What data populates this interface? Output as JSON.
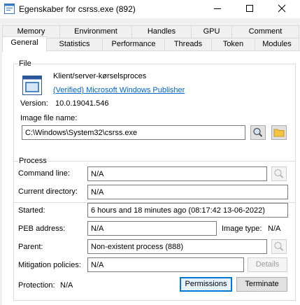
{
  "window": {
    "title": "Egenskaber for csrss.exe (892)"
  },
  "tabs": {
    "back_row": [
      "Memory",
      "Environment",
      "Handles",
      "GPU",
      "Comment"
    ],
    "front_row": [
      "General",
      "Statistics",
      "Performance",
      "Threads",
      "Token",
      "Modules"
    ],
    "active": "General"
  },
  "file": {
    "group_label": "File",
    "description": "Klient/server-kørselsproces",
    "publisher_link": "(Verified) Microsoft Windows Publisher",
    "version_label": "Version:",
    "version_value": "10.0.19041.546",
    "image_name_label": "Image file name:",
    "image_path": "C:\\Windows\\System32\\csrss.exe"
  },
  "process": {
    "group_label": "Process",
    "command_line_label": "Command line:",
    "command_line_value": "N/A",
    "current_dir_label": "Current directory:",
    "current_dir_value": "N/A",
    "started_label": "Started:",
    "started_value": "6 hours and 18 minutes ago (08:17:42 13-06-2022)",
    "peb_label": "PEB address:",
    "peb_value": "N/A",
    "image_type_label": "Image type:",
    "image_type_value": "N/A",
    "parent_label": "Parent:",
    "parent_value": "Non-existent process (888)",
    "mitigation_label": "Mitigation policies:",
    "mitigation_value": "N/A",
    "details_button": "Details",
    "protection_label": "Protection:",
    "protection_value": "N/A",
    "permissions_button": "Permissions",
    "terminate_button": "Terminate"
  },
  "colors": {
    "accent": "#0078d7",
    "link": "#0066cc"
  },
  "icons": [
    "app-icon",
    "minimize-icon",
    "maximize-icon",
    "close-icon",
    "exe-file-icon",
    "magnifier-icon",
    "folder-icon"
  ]
}
